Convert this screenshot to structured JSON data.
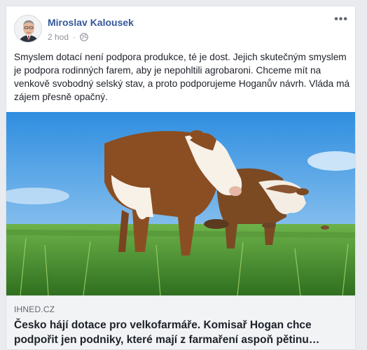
{
  "post": {
    "author": "Miroslav Kalousek",
    "time": "2 hod",
    "separator": "·",
    "privacy_icon": "globe-icon",
    "menu_label": "•••",
    "text": "Smyslem dotací není podpora produkce, té je dost. Jejich skutečným smyslem je podpora rodinných farem, aby je nepohltili agrobaroni. Chceme mít na venkově svobodný selský stav, a proto podporujeme Hoganův návrh. Vláda má zájem přesně opačný."
  },
  "link": {
    "domain": "IHNED.CZ",
    "headline": "Česko hájí dotace pro velkofarmáře. Komisař Hogan chce podpořit jen podniky, které mají z farmaření aspoň pětinu…"
  },
  "colors": {
    "author": "#365899",
    "text": "#1d2129",
    "meta": "#90949c",
    "link_bg": "#f2f3f5"
  }
}
